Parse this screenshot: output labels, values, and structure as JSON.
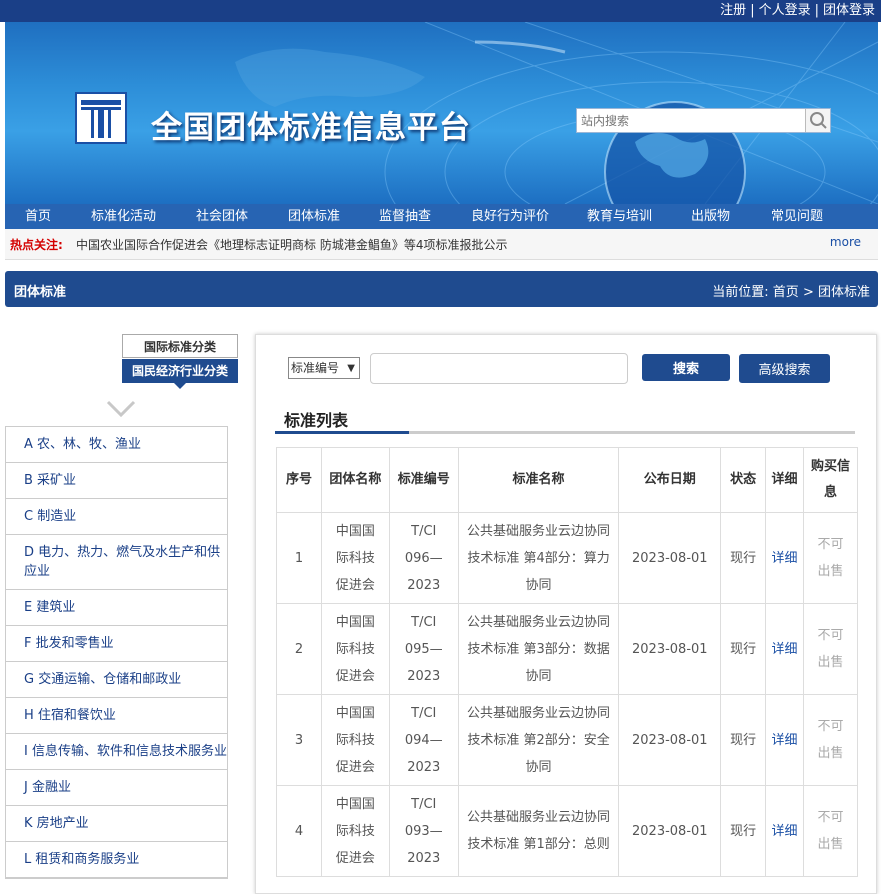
{
  "top_links": [
    "注册",
    "个人登录",
    "团体登录"
  ],
  "site": {
    "title": "全国团体标准信息平台",
    "search_placeholder": "站内搜索"
  },
  "nav": [
    "首页",
    "标准化活动",
    "社会团体",
    "团体标准",
    "监督抽查",
    "良好行为评价",
    "教育与培训",
    "出版物",
    "常见问题"
  ],
  "hot": {
    "label": "热点关注:",
    "text": "中国农业国际合作促进会《地理标志证明商标 防城港金鲳鱼》等4项标准报批公示",
    "more": "more"
  },
  "section": {
    "title": "团体标准",
    "crumb_prefix": "当前位置:",
    "crumb_home": "首页",
    "crumb_sep": ">",
    "crumb_current": "团体标准"
  },
  "class_tabs": {
    "intl": "国际标准分类",
    "national": "国民经济行业分类"
  },
  "categories": [
    "A 农、林、牧、渔业",
    "B 采矿业",
    "C 制造业",
    "D 电力、热力、燃气及水生产和供应业",
    "E 建筑业",
    "F 批发和零售业",
    "G 交通运输、仓储和邮政业",
    "H 住宿和餐饮业",
    "I 信息传输、软件和信息技术服务业",
    "J 金融业",
    "K 房地产业",
    "L 租赁和商务服务业"
  ],
  "search": {
    "select_value": "标准编号",
    "search_btn": "搜索",
    "adv_btn": "高级搜索"
  },
  "list": {
    "title": "标准列表",
    "headers": [
      "序号",
      "团体名称",
      "标准编号",
      "标准名称",
      "公布日期",
      "状态",
      "详细",
      "购买信息"
    ],
    "rows": [
      {
        "no": "1",
        "org": "中国国际科技促进会",
        "code": "T/CI 096—2023",
        "name": "公共基础服务业云边协同技术标准 第4部分：算力协同",
        "date": "2023-08-01",
        "status": "现行",
        "detail": "详细",
        "buy": "不可出售"
      },
      {
        "no": "2",
        "org": "中国国际科技促进会",
        "code": "T/CI 095—2023",
        "name": "公共基础服务业云边协同技术标准 第3部分：数据协同",
        "date": "2023-08-01",
        "status": "现行",
        "detail": "详细",
        "buy": "不可出售"
      },
      {
        "no": "3",
        "org": "中国国际科技促进会",
        "code": "T/CI 094—2023",
        "name": "公共基础服务业云边协同技术标准 第2部分：安全协同",
        "date": "2023-08-01",
        "status": "现行",
        "detail": "详细",
        "buy": "不可出售"
      },
      {
        "no": "4",
        "org": "中国国际科技促进会",
        "code": "T/CI 093—2023",
        "name": "公共基础服务业云边协同技术标准 第1部分：总则",
        "date": "2023-08-01",
        "status": "现行",
        "detail": "详细",
        "buy": "不可出售"
      }
    ]
  },
  "colors": {
    "primary": "#1f4b8f",
    "link": "#1a4fa5",
    "hot": "#d40000",
    "nav": "#2764b3"
  }
}
